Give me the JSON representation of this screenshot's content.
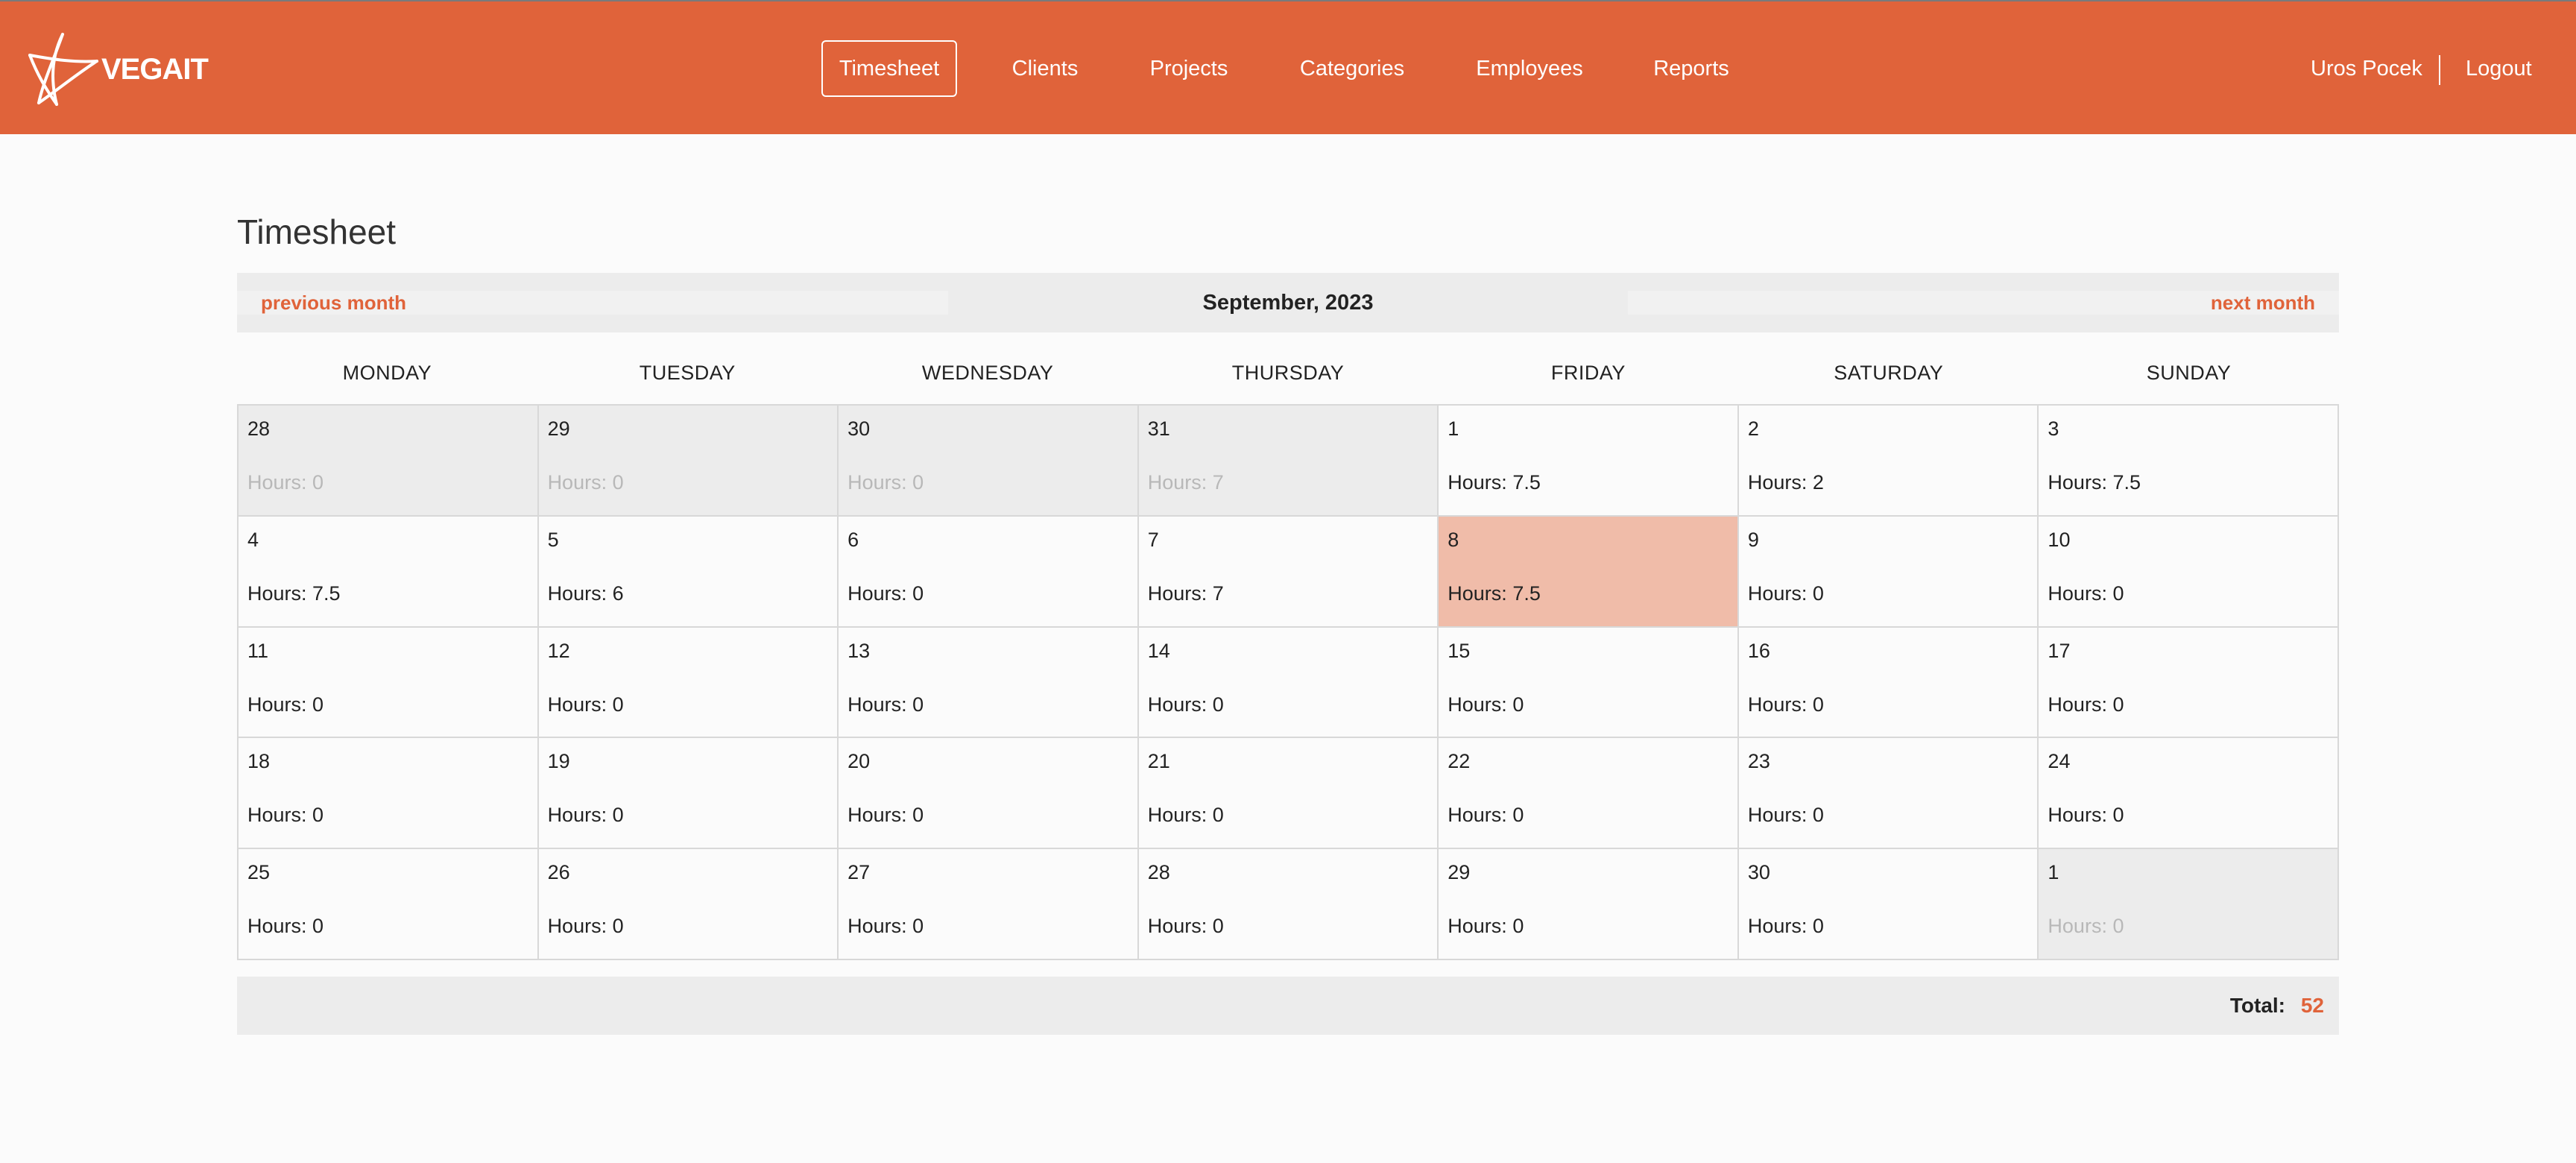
{
  "colors": {
    "brand": "#e0633a",
    "today_highlight": "#f0bca9",
    "other_month_bg": "#ececec"
  },
  "header": {
    "logo_text": "VEGAIT",
    "nav": [
      {
        "label": "Timesheet",
        "active": true
      },
      {
        "label": "Clients",
        "active": false
      },
      {
        "label": "Projects",
        "active": false
      },
      {
        "label": "Categories",
        "active": false
      },
      {
        "label": "Employees",
        "active": false
      },
      {
        "label": "Reports",
        "active": false
      }
    ],
    "user_name": "Uros Pocek",
    "logout_label": "Logout"
  },
  "main": {
    "title": "Timesheet",
    "prev_label": "previous month",
    "next_label": "next month",
    "month_label": "September, 2023",
    "weekdays": [
      "MONDAY",
      "TUESDAY",
      "WEDNESDAY",
      "THURSDAY",
      "FRIDAY",
      "SATURDAY",
      "SUNDAY"
    ],
    "hours_prefix": "Hours: ",
    "days": [
      {
        "day": "28",
        "hours": "0",
        "other": true
      },
      {
        "day": "29",
        "hours": "0",
        "other": true
      },
      {
        "day": "30",
        "hours": "0",
        "other": true
      },
      {
        "day": "31",
        "hours": "7",
        "other": true
      },
      {
        "day": "1",
        "hours": "7.5"
      },
      {
        "day": "2",
        "hours": "2"
      },
      {
        "day": "3",
        "hours": "7.5"
      },
      {
        "day": "4",
        "hours": "7.5"
      },
      {
        "day": "5",
        "hours": "6"
      },
      {
        "day": "6",
        "hours": "0"
      },
      {
        "day": "7",
        "hours": "7"
      },
      {
        "day": "8",
        "hours": "7.5",
        "today": true
      },
      {
        "day": "9",
        "hours": "0"
      },
      {
        "day": "10",
        "hours": "0"
      },
      {
        "day": "11",
        "hours": "0"
      },
      {
        "day": "12",
        "hours": "0"
      },
      {
        "day": "13",
        "hours": "0"
      },
      {
        "day": "14",
        "hours": "0"
      },
      {
        "day": "15",
        "hours": "0"
      },
      {
        "day": "16",
        "hours": "0"
      },
      {
        "day": "17",
        "hours": "0"
      },
      {
        "day": "18",
        "hours": "0"
      },
      {
        "day": "19",
        "hours": "0"
      },
      {
        "day": "20",
        "hours": "0"
      },
      {
        "day": "21",
        "hours": "0"
      },
      {
        "day": "22",
        "hours": "0"
      },
      {
        "day": "23",
        "hours": "0"
      },
      {
        "day": "24",
        "hours": "0"
      },
      {
        "day": "25",
        "hours": "0"
      },
      {
        "day": "26",
        "hours": "0"
      },
      {
        "day": "27",
        "hours": "0"
      },
      {
        "day": "28",
        "hours": "0"
      },
      {
        "day": "29",
        "hours": "0"
      },
      {
        "day": "30",
        "hours": "0"
      },
      {
        "day": "1",
        "hours": "0",
        "other": true
      }
    ],
    "total_label": "Total:",
    "total_value": "52"
  }
}
